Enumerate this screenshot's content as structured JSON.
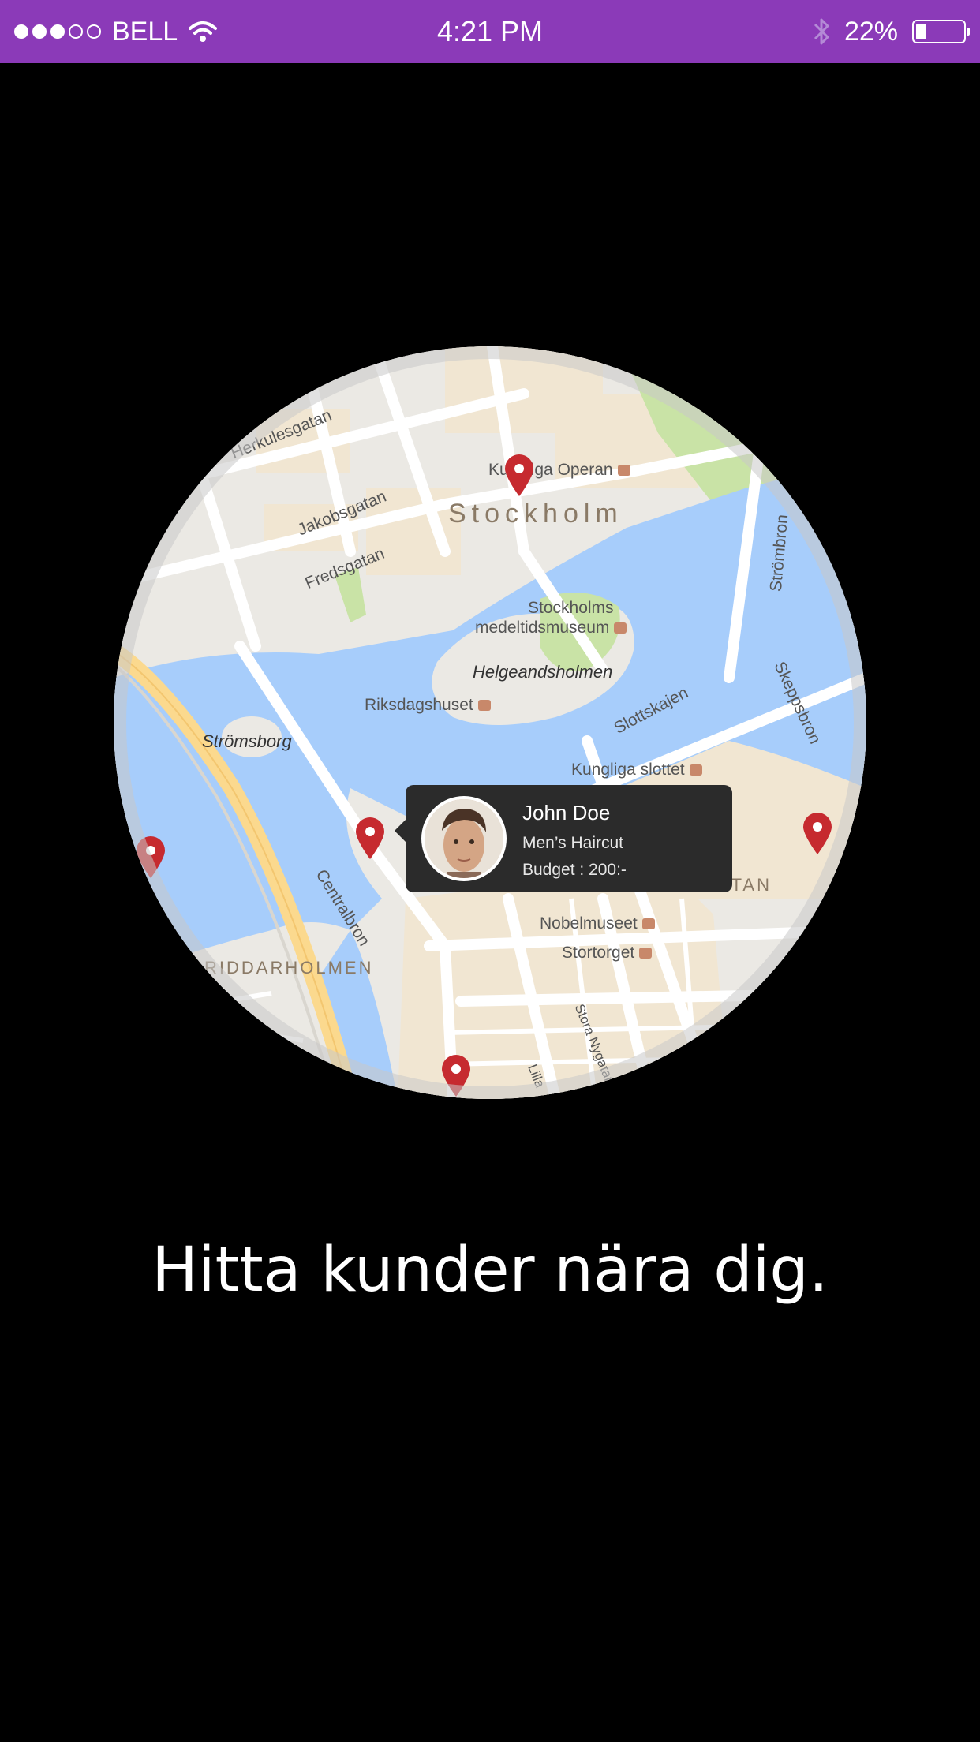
{
  "status_bar": {
    "carrier": "BELL",
    "signal_filled": 3,
    "signal_total": 5,
    "time": "4:21 PM",
    "battery_percent_text": "22%",
    "battery_level": 0.22,
    "background_color": "#8b3ab8"
  },
  "map": {
    "city_label": "Stockholm",
    "street_labels": {
      "herkulesgatan": "Herkulesgatan",
      "jakobsgatan": "Jakobsgatan",
      "fredsgatan": "Fredsgatan",
      "strombron": "Strömbron",
      "skeppsbron": "Skeppsbron",
      "slottskajen": "Slottskajen",
      "centralbron": "Centralbron",
      "stora_nygatan": "Stora Nygatan",
      "lilla": "Lilla"
    },
    "place_labels": {
      "kungliga_operan": "Kungliga Operan",
      "medeltidsmuseum_1": "Stockholms",
      "medeltidsmuseum_2": "medeltidsmuseum",
      "helgeandsholmen": "Helgeandsholmen",
      "riksdagshuset": "Riksdagshuset",
      "stromsborg": "Strömsborg",
      "kungliga_slottet": "Kungliga slottet",
      "gamla_stan": "GAMLA STAN",
      "nobelmuseet": "Nobelmuseet",
      "stortorget": "Stortorget",
      "riddarholmen": "RIDDARHOLMEN"
    },
    "pin_color": "#c62a2f",
    "popup": {
      "name": "John Doe",
      "service": "Men’s Haircut",
      "budget": "Budget : 200:-"
    }
  },
  "headline": "Hitta kunder nära dig."
}
